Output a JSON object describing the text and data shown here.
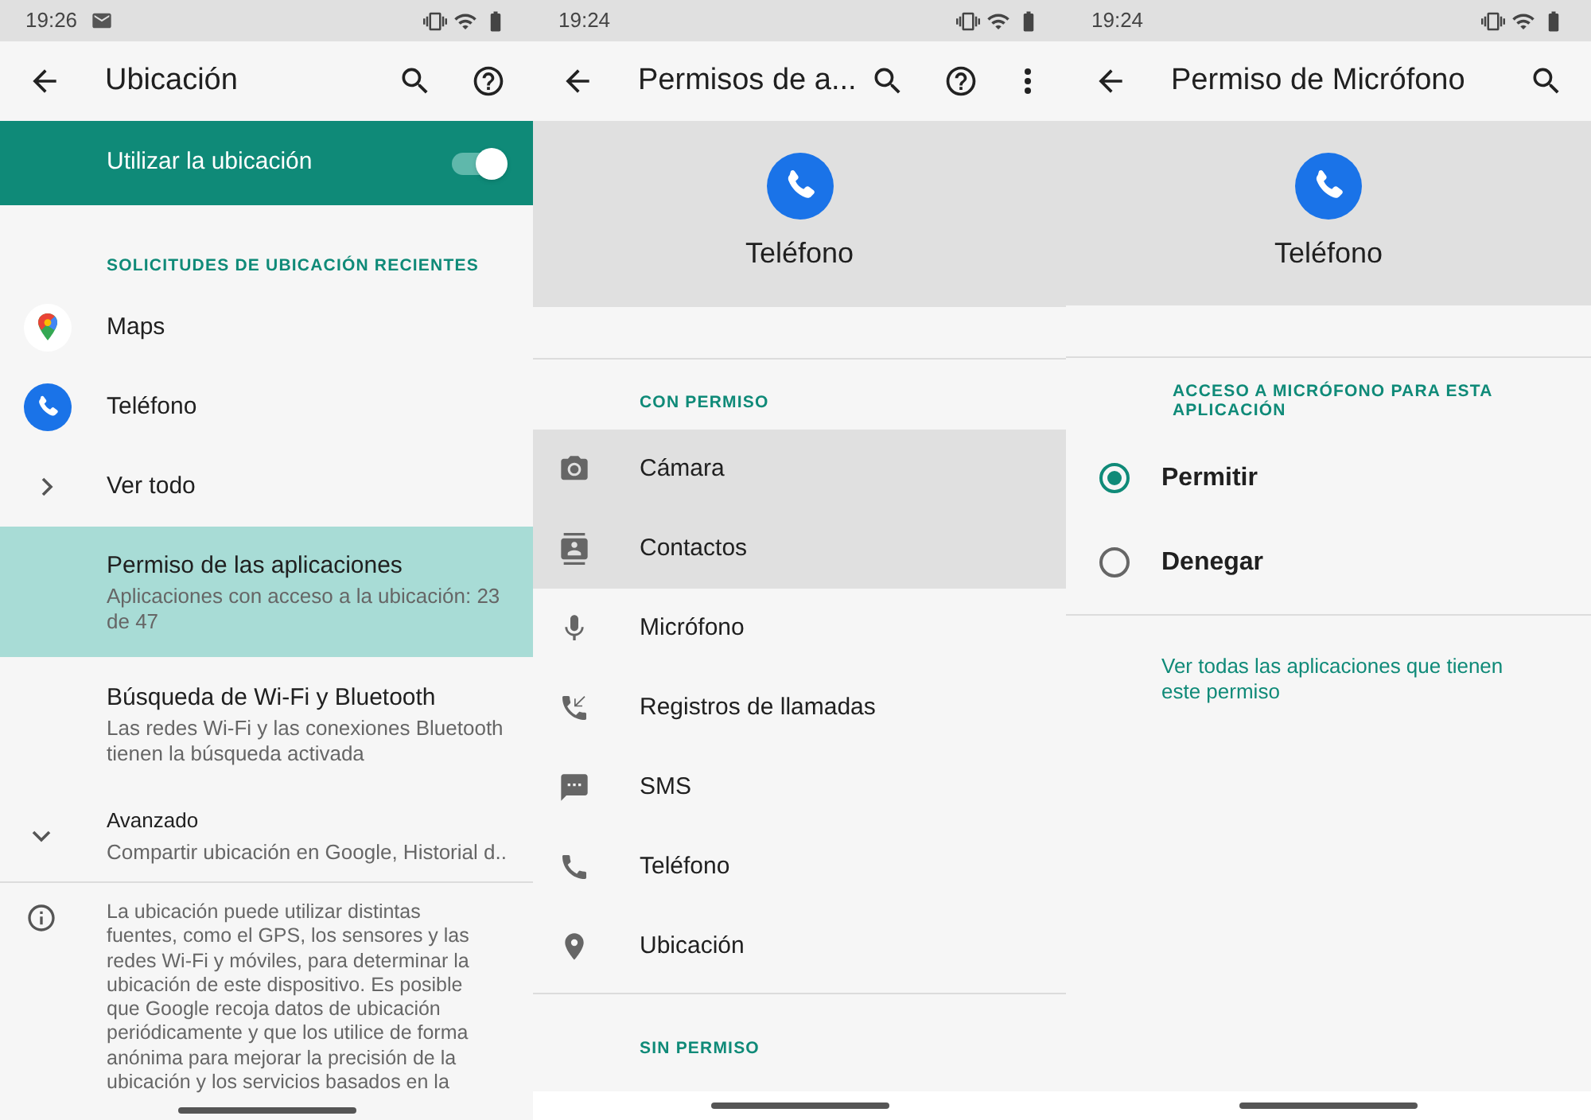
{
  "location_screen": {
    "status_time": "19:26",
    "title": "Ubicación",
    "toggle": {
      "label": "Utilizar la ubicación",
      "on": true
    },
    "recent_header": "SOLICITUDES DE UBICACIÓN RECIENTES",
    "recent_apps": [
      {
        "label": "Maps"
      },
      {
        "label": "Teléfono"
      },
      {
        "label": "Ver todo"
      }
    ],
    "settings": [
      {
        "title": "Permiso de las aplicaciones",
        "subtitle": "Aplicaciones con acceso a la ubicación: 23 de 47",
        "highlighted": true
      },
      {
        "title": "Búsqueda de Wi-Fi y Bluetooth",
        "subtitle": "Las redes Wi-Fi y las conexiones Bluetooth tienen la búsqueda activada",
        "highlighted": false
      }
    ],
    "advanced": {
      "title": "Avanzado",
      "subtitle": "Compartir ubicación en Google, Historial d..",
      "expanded": false
    },
    "info": "La ubicación puede utilizar distintas fuentes, como el GPS, los sensores y las redes Wi-Fi y móviles, para determinar la ubicación de este dispositivo. Es posible que Google recoja datos de ubicación periódicamente y que los utilice de forma anónima para mejorar la precisión de la ubicación y los servicios basados en la"
  },
  "app_permissions_screen": {
    "status_time": "19:24",
    "title": "Permisos de a...",
    "app_name": "Teléfono",
    "allowed_header": "CON PERMISO",
    "allowed": [
      {
        "label": "Cámara",
        "highlighted": true
      },
      {
        "label": "Contactos",
        "highlighted": true
      },
      {
        "label": "Micrófono",
        "highlighted": false
      },
      {
        "label": "Registros de llamadas",
        "highlighted": false
      },
      {
        "label": "SMS",
        "highlighted": false
      },
      {
        "label": "Teléfono",
        "highlighted": false
      },
      {
        "label": "Ubicación",
        "highlighted": false
      }
    ],
    "denied_header": "SIN PERMISO"
  },
  "mic_permission_screen": {
    "status_time": "19:24",
    "title": "Permiso de Micrófono",
    "app_name": "Teléfono",
    "access_header": "ACCESO A MICRÓFONO PARA ESTA APLICACIÓN",
    "options": [
      {
        "label": "Permitir",
        "selected": true
      },
      {
        "label": "Denegar",
        "selected": false
      }
    ],
    "link": "Ver todas las aplicaciones que tienen este permiso"
  }
}
